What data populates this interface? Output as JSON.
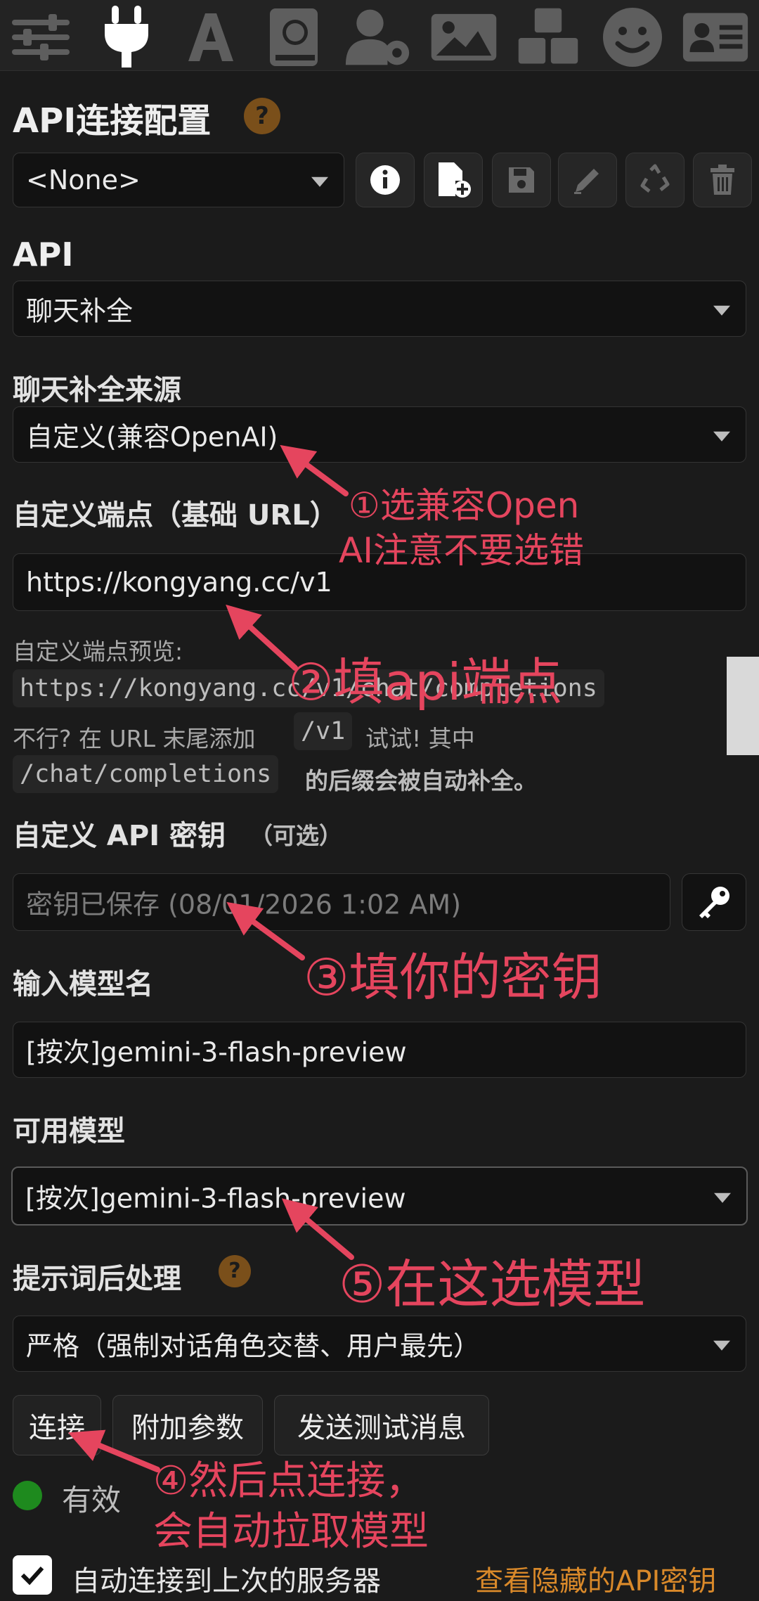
{
  "topbar": {
    "icons": [
      "sliders-icon",
      "plug-icon",
      "font-icon",
      "book-globe-icon",
      "user-gear-icon",
      "image-icon",
      "cubes-icon",
      "smile-icon",
      "id-card-icon"
    ]
  },
  "connection": {
    "title": "API连接配置",
    "help": "?",
    "profile_value": "<None>"
  },
  "api": {
    "label": "API",
    "value": "聊天补全"
  },
  "source": {
    "label": "聊天补全来源",
    "value": "自定义(兼容OpenAI)"
  },
  "endpoint": {
    "label": "自定义端点（基础 URL）",
    "value": "https://kongyang.cc/v1",
    "preview_label": "自定义端点预览:",
    "preview_value": "https://kongyang.cc/v1/chat/completions",
    "hint_a": "不行? 在 URL 末尾添加",
    "hint_code1": "/v1",
    "hint_b": "试试! 其中",
    "hint_code2": "/chat/completions",
    "hint_c": "的后缀会被自动补全。"
  },
  "apikey": {
    "label": "自定义 API 密钥",
    "optional": "（可选）",
    "placeholder": "密钥已保存 (08/01/2026 1:02 AM)"
  },
  "model_input": {
    "label": "输入模型名",
    "value": "[按次]gemini-3-flash-preview"
  },
  "available": {
    "label": "可用模型",
    "value": "[按次]gemini-3-flash-preview"
  },
  "postproc": {
    "label": "提示词后处理",
    "help": "?",
    "value": "严格（强制对话角色交替、用户最先）"
  },
  "buttons": {
    "connect": "连接",
    "extra_params": "附加参数",
    "send_test": "发送测试消息"
  },
  "status": {
    "text": "有效",
    "color": "#1e8a1e"
  },
  "footer": {
    "auto_connect": "自动连接到上次的服务器",
    "view_keys": "查看隐藏的API密钥",
    "checked": true
  },
  "annotations": {
    "a1_line1": "①选兼容Open",
    "a1_line2": "AI注意不要选错",
    "a2": "②填api端点",
    "a3": "③填你的密钥",
    "a4_line1": "④然后点连接，",
    "a4_line2": "会自动拉取模型",
    "a5": "⑤在这选模型",
    "color": "#e5455e"
  }
}
